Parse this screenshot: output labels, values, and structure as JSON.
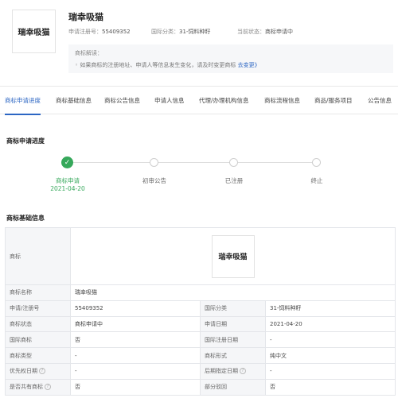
{
  "header": {
    "logo_text": "瑞幸吸猫",
    "title": "瑞幸吸猫",
    "reg_no_label": "申请注册号：",
    "reg_no": "55409352",
    "class_label": "国际分类：",
    "class_value": "31-饲料种籽",
    "status_label": "当前状态：",
    "status_value": "商标申请中",
    "explain_title": "商标解读：",
    "explain_text": "◦ 如果商标的注册地址、申请人等信息发生变化，请及时变更商标",
    "explain_link": "去变更》"
  },
  "tabs": [
    "商标申请进度",
    "商标基础信息",
    "商标公告信息",
    "申请人信息",
    "代理/办理机构信息",
    "商标流程信息",
    "商品/服务项目",
    "公告信息"
  ],
  "progress": {
    "title": "商标申请进度",
    "steps": [
      {
        "label": "商标申请",
        "date": "2021-04-20",
        "done": true
      },
      {
        "label": "初审公告",
        "date": "",
        "done": false
      },
      {
        "label": "已注册",
        "date": "",
        "done": false
      },
      {
        "label": "终止",
        "date": "",
        "done": false
      }
    ]
  },
  "basic_info": {
    "title": "商标基础信息",
    "mark_label": "商标",
    "mark_text": "瑞幸吸猫",
    "name_label": "商标名称",
    "name_value": "瑞幸吸猫",
    "rows": [
      {
        "k1": "申请/注册号",
        "v1": "55409352",
        "k2": "国际分类",
        "v2": "31-饲料种籽"
      },
      {
        "k1": "商标状态",
        "v1": "商标申请中",
        "k2": "申请日期",
        "v2": "2021-04-20"
      },
      {
        "k1": "国际商标",
        "v1": "否",
        "k2": "国际注册日期",
        "v2": "-"
      },
      {
        "k1": "商标类型",
        "v1": "-",
        "k2": "商标形式",
        "v2": "纯中文"
      },
      {
        "k1": "优先权日期",
        "v1": "-",
        "k2": "后期指定日期",
        "v2": "-"
      },
      {
        "k1": "是否共有商标",
        "v1": "否",
        "k2": "部分驳回",
        "v2": "否"
      }
    ]
  }
}
